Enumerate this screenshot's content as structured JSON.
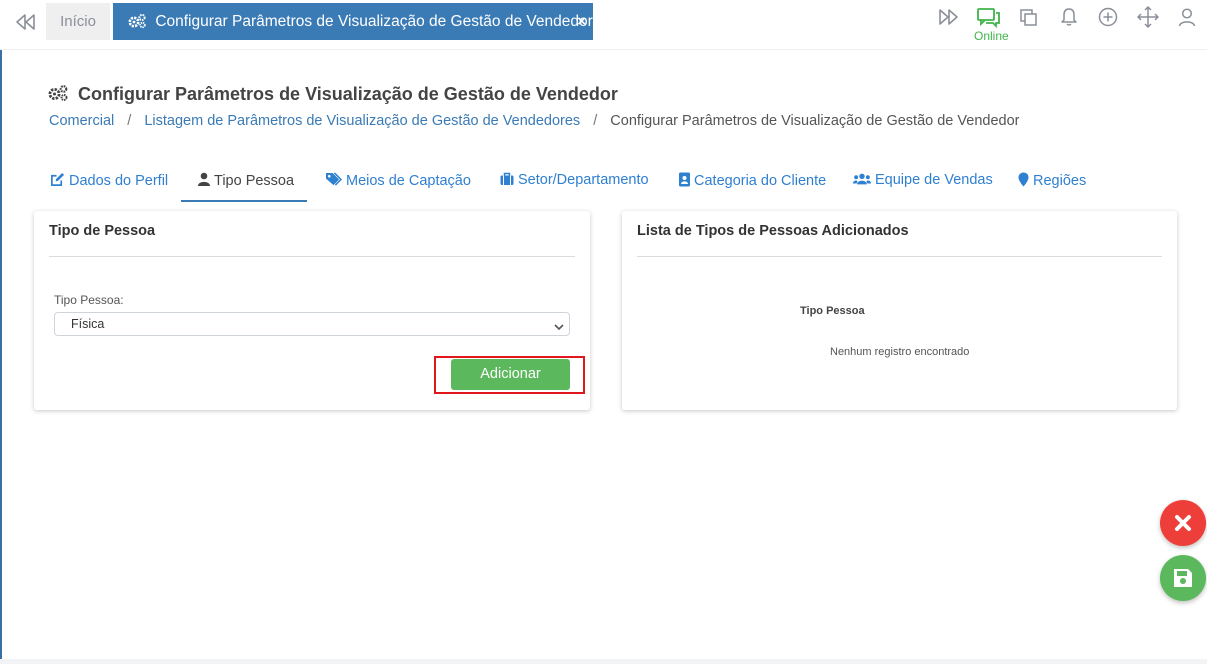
{
  "top_bar": {
    "home_tab": "Início",
    "active_tab": "Configurar Parâmetros de Visualização de Gestão de Vendedor",
    "close_symbol": "×",
    "online_label": "Online",
    "icons": [
      "fast-forward-icon",
      "chat-icon",
      "copy-icon",
      "bell-icon",
      "plus-circle-icon",
      "move-icon",
      "user-icon"
    ]
  },
  "page": {
    "title": "Configurar Parâmetros de Visualização de Gestão de Vendedor",
    "breadcrumb": [
      "Comercial",
      "Listagem de Parâmetros de Visualização de Gestão de Vendedores",
      "Configurar Parâmetros de Visualização de Gestão de Vendedor"
    ],
    "breadcrumb_separator": "/"
  },
  "tabs": [
    {
      "label": "Dados do Perfil",
      "icon": "edit-icon",
      "active": false
    },
    {
      "label": "Tipo Pessoa",
      "icon": "user-icon",
      "active": true
    },
    {
      "label": "Meios de Captação",
      "icon": "tags-icon",
      "active": false
    },
    {
      "label": "Setor/Departamento",
      "icon": "briefcase-icon",
      "active": false
    },
    {
      "label": "Categoria do Cliente",
      "icon": "id-badge-icon",
      "active": false
    },
    {
      "label": "Equipe de Vendas",
      "icon": "users-icon",
      "active": false
    },
    {
      "label": "Regiões",
      "icon": "map-marker-icon",
      "active": false
    }
  ],
  "left_card": {
    "title": "Tipo de Pessoa",
    "field_label": "Tipo Pessoa:",
    "select_value": "Física",
    "add_button": "Adicionar"
  },
  "right_card": {
    "title": "Lista de Tipos de Pessoas Adicionados",
    "column_header": "Tipo Pessoa",
    "empty_message": "Nenhum registro encontrado"
  },
  "colors": {
    "primary": "#3a7ab5",
    "link": "#2f80d1",
    "success": "#5cb85c",
    "danger": "#ee3e3a",
    "online": "#3fb54a",
    "highlight": "#e0171b"
  }
}
